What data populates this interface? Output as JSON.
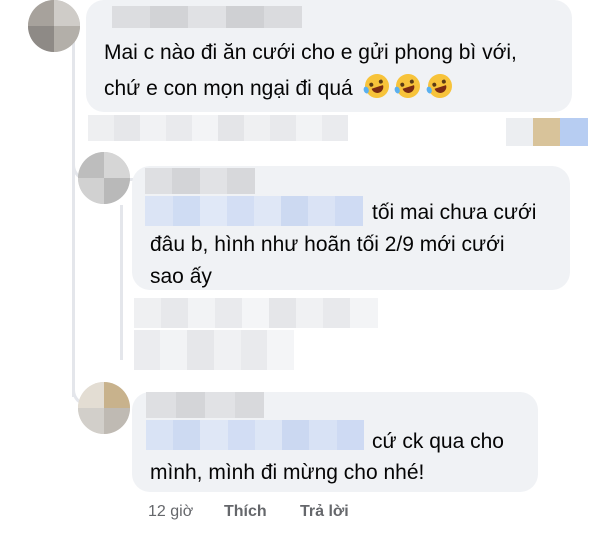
{
  "comments": [
    {
      "text_lines": [
        "Mai c nào đi ăn cưới cho e gửi phong bì với,",
        "chứ e con mọn ngại đi quá"
      ],
      "emoji_icons": [
        "rolling-on-floor-laughing",
        "rolling-on-floor-laughing",
        "rolling-on-floor-laughing"
      ]
    },
    {
      "text_lines": [
        "tối mai chưa cưới",
        "đâu b, hình như hoãn tối 2/9 mới cưới",
        "sao ấy"
      ]
    },
    {
      "text_lines": [
        "cứ ck qua cho",
        "mình, mình đi mừng cho nhé!"
      ],
      "footer": {
        "time": "12 giờ",
        "like": "Thích",
        "reply": "Trả lời"
      }
    }
  ],
  "colors": {
    "bubble": "#f0f2f5",
    "text": "#050505",
    "meta": "#65676b",
    "thread_line": "#e4e6eb"
  }
}
